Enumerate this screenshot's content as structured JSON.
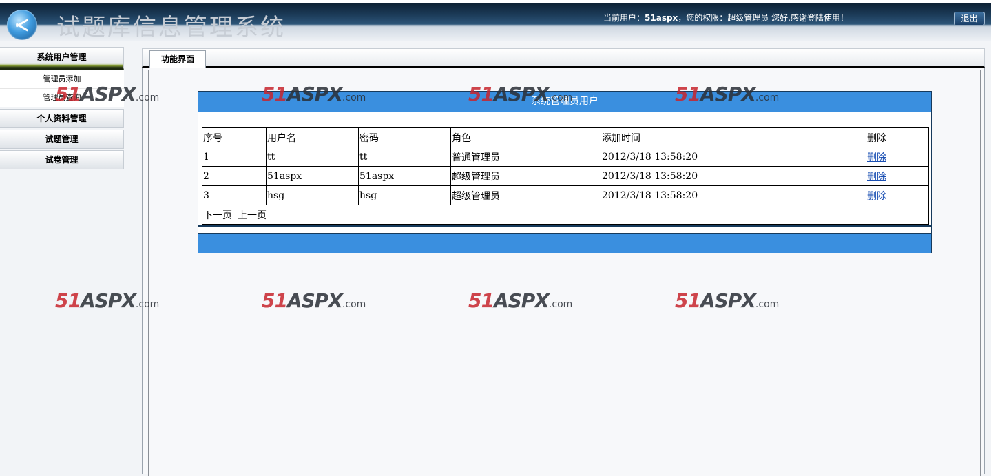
{
  "header": {
    "app_title": "试题库信息管理系统",
    "user_prefix": "当前用户：",
    "user_name": "51aspx",
    "user_suffix": "，您的权限：超级管理员 您好,感谢登陆使用！",
    "logout_label": "退出"
  },
  "sidebar": {
    "groups": [
      {
        "label": "系统用户管理",
        "items": [
          "管理员添加",
          "管理员查询"
        ]
      },
      {
        "label": "个人资料管理"
      },
      {
        "label": "试题管理"
      },
      {
        "label": "试卷管理"
      }
    ]
  },
  "tab": {
    "label": "功能界面"
  },
  "panel": {
    "title": "系统管理员用户",
    "columns": [
      "序号",
      "用户名",
      "密码",
      "角色",
      "添加时间",
      "删除"
    ],
    "rows": [
      {
        "id": "1",
        "username": "tt",
        "password": "tt",
        "role": "普通管理员",
        "time": "2012/3/18 13:58:20",
        "action": "删除"
      },
      {
        "id": "2",
        "username": "51aspx",
        "password": "51aspx",
        "role": "超级管理员",
        "time": "2012/3/18 13:58:20",
        "action": "删除"
      },
      {
        "id": "3",
        "username": "hsg",
        "password": "hsg",
        "role": "超级管理员",
        "time": "2012/3/18 13:58:20",
        "action": "删除"
      }
    ],
    "pager": {
      "next": "下一页",
      "prev": "上一页"
    }
  },
  "watermark": {
    "num": "51",
    "brand": "ASPX",
    "tld": ".com"
  }
}
